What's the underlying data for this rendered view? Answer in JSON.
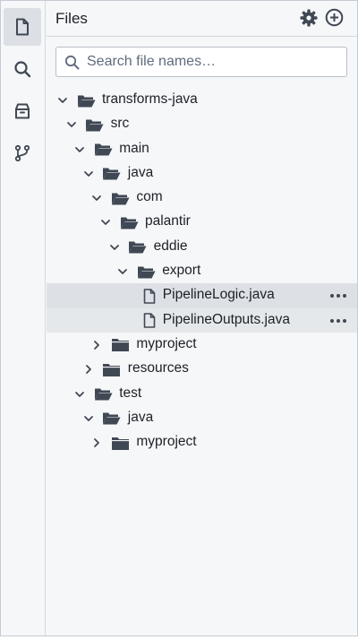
{
  "panel": {
    "title": "Files"
  },
  "rail": {
    "items": [
      {
        "icon": "file-icon",
        "active": true
      },
      {
        "icon": "search-icon",
        "active": false
      },
      {
        "icon": "package-icon",
        "active": false
      },
      {
        "icon": "git-branch-icon",
        "active": false
      }
    ]
  },
  "header_actions": [
    {
      "icon": "gear-icon"
    },
    {
      "icon": "add-circle-icon"
    }
  ],
  "search": {
    "placeholder": "Search file names…",
    "value": ""
  },
  "tree": [
    {
      "label": "transforms-java",
      "type": "folder",
      "depth": 0,
      "expanded": true
    },
    {
      "label": "src",
      "type": "folder",
      "depth": 1,
      "expanded": true
    },
    {
      "label": "main",
      "type": "folder",
      "depth": 2,
      "expanded": true
    },
    {
      "label": "java",
      "type": "folder",
      "depth": 3,
      "expanded": true
    },
    {
      "label": "com",
      "type": "folder",
      "depth": 4,
      "expanded": true
    },
    {
      "label": "palantir",
      "type": "folder",
      "depth": 5,
      "expanded": true
    },
    {
      "label": "eddie",
      "type": "folder",
      "depth": 6,
      "expanded": true
    },
    {
      "label": "export",
      "type": "folder",
      "depth": 7,
      "expanded": true
    },
    {
      "label": "PipelineLogic.java",
      "type": "file",
      "depth": 8,
      "selected": true,
      "more": true
    },
    {
      "label": "PipelineOutputs.java",
      "type": "file",
      "depth": 8,
      "hovered": true,
      "more": true
    },
    {
      "label": "myproject",
      "type": "folder",
      "depth": 4,
      "expanded": false
    },
    {
      "label": "resources",
      "type": "folder",
      "depth": 3,
      "expanded": false
    },
    {
      "label": "test",
      "type": "folder",
      "depth": 2,
      "expanded": true
    },
    {
      "label": "java",
      "type": "folder",
      "depth": 3,
      "expanded": true
    },
    {
      "label": "myproject",
      "type": "folder",
      "depth": 4,
      "expanded": false
    }
  ]
}
